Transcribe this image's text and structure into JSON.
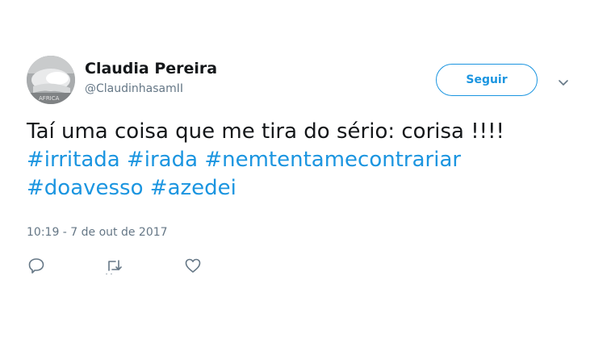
{
  "author": {
    "display_name": "Claudia Pereira",
    "handle": "@ClaudinhasamII",
    "avatar_text": "AFRICA"
  },
  "follow_button": {
    "label": "Seguir"
  },
  "menu": {
    "icon": "chevron-down-icon"
  },
  "tweet": {
    "line1": "Taí uma coisa que me tira do sério:  corisa !!!!",
    "hashtags": [
      "#irritada",
      "#irada",
      "#nemtentamecontrariar",
      "#doavesso",
      "#azedei"
    ],
    "timestamp": "10:19 - 7 de out de 2017"
  },
  "actions": [
    {
      "name": "reply",
      "icon": "reply-icon"
    },
    {
      "name": "retweet",
      "icon": "retweet-icon"
    },
    {
      "name": "like",
      "icon": "heart-icon"
    }
  ],
  "colors": {
    "link": "#1b95e0",
    "secondary_text": "#657786",
    "primary_text": "#14171a",
    "icon": "#657786"
  }
}
